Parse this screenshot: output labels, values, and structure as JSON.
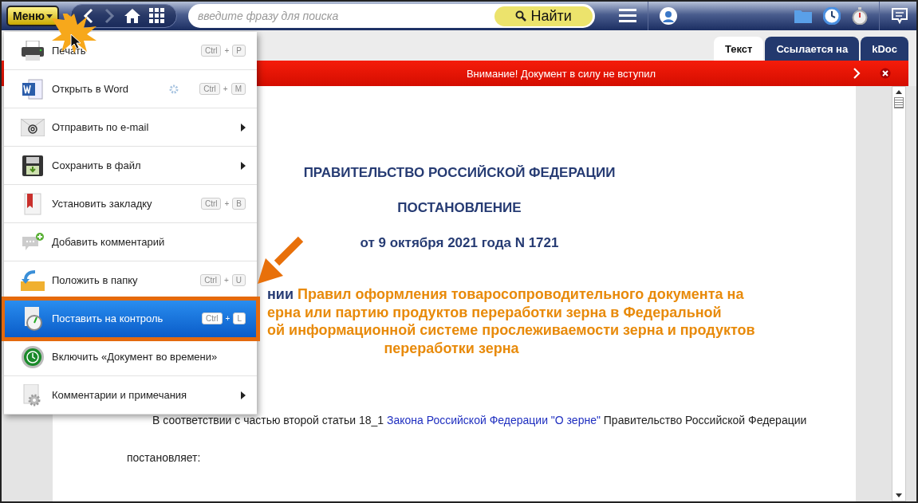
{
  "toolbar": {
    "menu_button": "Меню",
    "forward_disabled": true,
    "search": {
      "placeholder": "введите фразу для поиска"
    },
    "search_button": "Найти"
  },
  "tabs": [
    {
      "label": "Текст",
      "selected": true
    },
    {
      "label": "Ссылается на",
      "selected": false
    },
    {
      "label": "kDoc",
      "selected": false
    }
  ],
  "banner": {
    "text": "Внимание! Документ в силу не вступил"
  },
  "document": {
    "headings": [
      "ПРАВИТЕЛЬСТВО РОССИЙСКОЙ ФЕДЕРАЦИИ",
      "ПОСТАНОВЛЕНИЕ",
      "от 9 октября 2021 года N 1721"
    ],
    "title_lines": [
      {
        "parts": [
          {
            "kind": "plain",
            "text": "нии"
          },
          {
            "kind": "accent",
            "text": "Правил оформления товаросопроводительного документа на"
          }
        ]
      },
      {
        "parts": [
          {
            "kind": "accent",
            "text": "ерна или партию продуктов переработки зерна в Федеральной"
          }
        ]
      },
      {
        "parts": [
          {
            "kind": "accent",
            "text": "ой информационной системе прослеживаемости зерна и продуктов"
          }
        ]
      },
      {
        "parts": [
          {
            "kind": "accent",
            "text": "переработки зерна"
          }
        ]
      }
    ],
    "paragraph": {
      "before": "В соответствии с частью второй статьи 18_1",
      "link": "Закона Российской Федерации \"О зерне\"",
      "after": "Правительство Российской Федерации"
    },
    "decree_word": "постановляет:"
  },
  "menu": {
    "items": [
      {
        "label": "Печать",
        "keys": [
          "Ctrl",
          "P"
        ],
        "joiner": "+",
        "submenu": false,
        "settings": false,
        "selected": false
      },
      {
        "label": "Открыть в Word",
        "keys": [
          "Ctrl",
          "M"
        ],
        "joiner": "+",
        "submenu": false,
        "settings": true,
        "selected": false
      },
      {
        "label": "Отправить по e-mail",
        "submenu": true,
        "settings": false,
        "selected": false
      },
      {
        "label": "Сохранить в файл",
        "submenu": true,
        "settings": false,
        "selected": false
      },
      {
        "label": "Установить закладку",
        "keys": [
          "Ctrl",
          "B"
        ],
        "joiner": "+",
        "submenu": false,
        "settings": false,
        "selected": false
      },
      {
        "label": "Добавить комментарий",
        "submenu": false,
        "settings": false,
        "selected": false
      },
      {
        "label": "Положить в папку",
        "keys": [
          "Ctrl",
          "U"
        ],
        "joiner": "+",
        "submenu": false,
        "settings": false,
        "selected": false
      },
      {
        "label": "Поставить на контроль",
        "keys": [
          "Ctrl",
          "L"
        ],
        "joiner": "+",
        "submenu": false,
        "settings": false,
        "selected": true
      },
      {
        "label": "Включить «Документ во времени»",
        "submenu": false,
        "settings": false,
        "selected": false
      },
      {
        "label": "Комментарии и примечания",
        "submenu": true,
        "settings": false,
        "selected": false
      }
    ]
  }
}
